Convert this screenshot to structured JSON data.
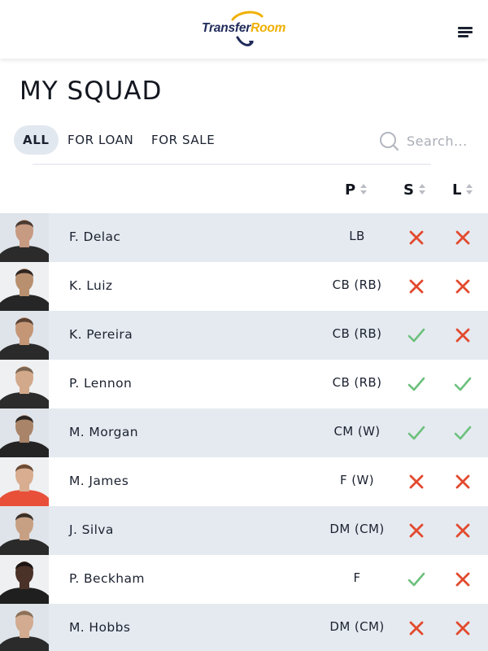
{
  "header": {
    "logo_part1": "Transfer",
    "logo_part2": "Room",
    "brand_colors": {
      "navy": "#1f2a5a",
      "gold": "#f0b000"
    },
    "menu_icon": "hamburger-menu-icon"
  },
  "page": {
    "title": "MY SQUAD"
  },
  "filters": [
    {
      "label": "ALL",
      "active": true
    },
    {
      "label": "FOR LOAN",
      "active": false
    },
    {
      "label": "FOR SALE",
      "active": false
    }
  ],
  "search": {
    "placeholder": "Search...",
    "value": "",
    "icon": "search-icon"
  },
  "columns": {
    "position": "P",
    "sale": "S",
    "loan": "L"
  },
  "status_colors": {
    "yes": "#6cc07c",
    "no": "#e24a2e",
    "row_shade": "#e5eaf0"
  },
  "players": [
    {
      "name": "F. Delac",
      "position": "LB",
      "sale": false,
      "loan": false,
      "shirt": "#2b2b2b",
      "skin": "#c79a82",
      "hair": "#4a3a30"
    },
    {
      "name": "K. Luiz",
      "position": "CB (RB)",
      "sale": false,
      "loan": false,
      "shirt": "#262626",
      "skin": "#b8906f",
      "hair": "#2e2520"
    },
    {
      "name": "K. Pereira",
      "position": "CB (RB)",
      "sale": true,
      "loan": false,
      "shirt": "#2a2a2a",
      "skin": "#c49676",
      "hair": "#5a4233"
    },
    {
      "name": "P. Lennon",
      "position": "CB (RB)",
      "sale": true,
      "loan": true,
      "shirt": "#2c2c2c",
      "skin": "#d3a98c",
      "hair": "#7a6550"
    },
    {
      "name": "M. Morgan",
      "position": "CM (W)",
      "sale": true,
      "loan": true,
      "shirt": "#242424",
      "skin": "#a98468",
      "hair": "#2a2420"
    },
    {
      "name": "M. James",
      "position": "F (W)",
      "sale": false,
      "loan": false,
      "shirt": "#e8503a",
      "skin": "#d8ad90",
      "hair": "#6b4a34"
    },
    {
      "name": "J. Silva",
      "position": "DM (CM)",
      "sale": false,
      "loan": false,
      "shirt": "#2a2a2a",
      "skin": "#c7a084",
      "hair": "#3a2f28"
    },
    {
      "name": "P. Beckham",
      "position": "F",
      "sale": true,
      "loan": false,
      "shirt": "#1f1f1f",
      "skin": "#4a3228",
      "hair": "#1c1512"
    },
    {
      "name": "M. Hobbs",
      "position": "DM (CM)",
      "sale": false,
      "loan": false,
      "shirt": "#2b2b2b",
      "skin": "#d2ab90",
      "hair": "#8a7058"
    }
  ]
}
